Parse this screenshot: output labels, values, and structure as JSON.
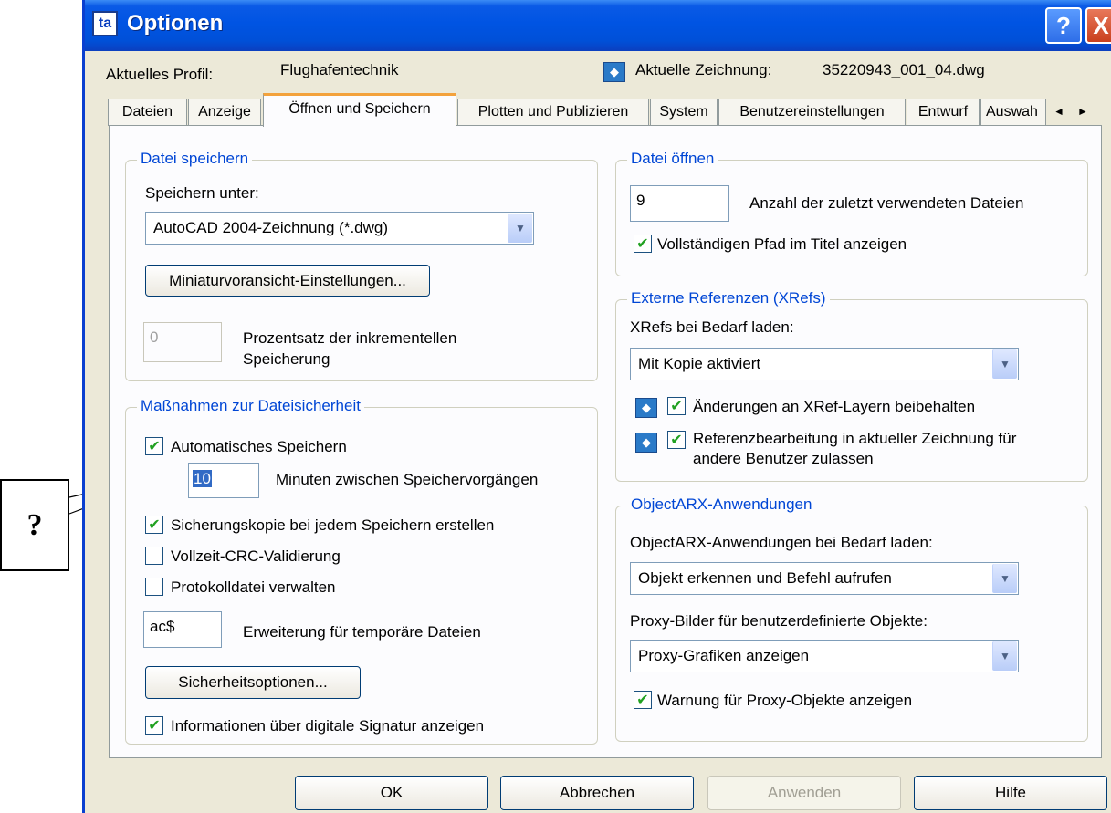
{
  "window": {
    "title": "Optionen",
    "help_glyph": "?",
    "close_glyph": "X",
    "app_icon_glyph": "ta"
  },
  "profile": {
    "label": "Aktuelles Profil:",
    "value": "Flughafentechnik"
  },
  "drawing": {
    "label": "Aktuelle Zeichnung:",
    "value": "35220943_001_04.dwg",
    "icon": "drawing-icon"
  },
  "tabs": [
    {
      "label": "Dateien"
    },
    {
      "label": "Anzeige"
    },
    {
      "label": "Öffnen und Speichern",
      "active": true
    },
    {
      "label": "Plotten und Publizieren"
    },
    {
      "label": "System"
    },
    {
      "label": "Benutzereinstellungen"
    },
    {
      "label": "Entwurf"
    },
    {
      "label": "Auswah"
    }
  ],
  "tab_scroll": {
    "left": "◄",
    "right": "►"
  },
  "save": {
    "legend": "Datei speichern",
    "save_as_label": "Speichern unter:",
    "save_as_value": "AutoCAD 2004-Zeichnung (*.dwg)",
    "thumbnail_button": "Miniaturvoransicht-Einstellungen...",
    "incremental_value": "0",
    "incremental_label_1": "Prozentsatz der inkrementellen",
    "incremental_label_2": "Speicherung"
  },
  "safety": {
    "legend": "Maßnahmen zur Dateisicherheit",
    "autosave_label": "Automatisches Speichern",
    "autosave_checked": true,
    "minutes_value": "10",
    "minutes_label": "Minuten zwischen Speichervorgängen",
    "backup_label": "Sicherungskopie bei jedem Speichern erstellen",
    "backup_checked": true,
    "crc_label": "Vollzeit-CRC-Validierung",
    "crc_checked": false,
    "log_label": "Protokolldatei verwalten",
    "log_checked": false,
    "ext_value": "ac$",
    "ext_label": "Erweiterung für temporäre Dateien",
    "security_button": "Sicherheitsoptionen...",
    "signature_label": "Informationen über digitale Signatur anzeigen",
    "signature_checked": true
  },
  "open": {
    "legend": "Datei öffnen",
    "recent_value": "9",
    "recent_label": "Anzahl der zuletzt verwendeten Dateien",
    "fullpath_label": "Vollständigen Pfad im Titel anzeigen",
    "fullpath_checked": true
  },
  "xrefs": {
    "legend": "Externe Referenzen (XRefs)",
    "load_label": "XRefs bei Bedarf laden:",
    "load_value": "Mit Kopie aktiviert",
    "retain_label": "Änderungen an XRef-Layern beibehalten",
    "retain_checked": true,
    "edit_label_1": "Referenzbearbeitung in aktueller Zeichnung für",
    "edit_label_2": "andere Benutzer zulassen",
    "edit_checked": true
  },
  "arx": {
    "legend": "ObjectARX-Anwendungen",
    "load_label": "ObjectARX-Anwendungen bei Bedarf laden:",
    "load_value": "Objekt erkennen und Befehl aufrufen",
    "proxy_label": "Proxy-Bilder für benutzerdefinierte Objekte:",
    "proxy_value": "Proxy-Grafiken anzeigen",
    "warn_label": "Warnung für Proxy-Objekte anzeigen",
    "warn_checked": true
  },
  "footer": {
    "ok": "OK",
    "cancel": "Abbrechen",
    "apply": "Anwenden",
    "help": "Hilfe"
  },
  "callout": {
    "text": "?"
  },
  "check_glyph": "✔",
  "arrow_glyph": "▼"
}
